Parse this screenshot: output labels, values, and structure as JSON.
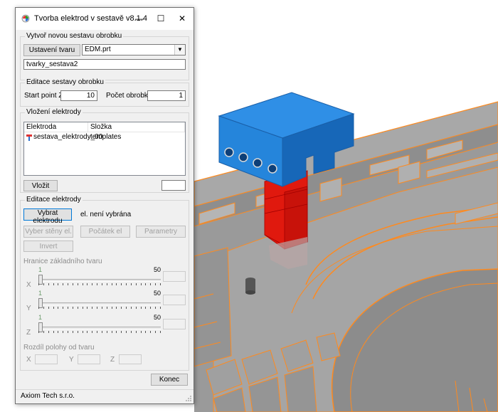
{
  "window": {
    "title": "Tvorba elektrod v sestavě v8.1.4"
  },
  "group_create_assembly": {
    "label": "Vytvoř novou sestavu obrobku",
    "shape_button": "Ustavení tvaru",
    "part_combo_value": "EDM.prt",
    "assembly_name_value": "tvarky_sestava2"
  },
  "group_edit_assembly": {
    "label": "Editace sestavy obrobku",
    "start_point_label": "Start point Z",
    "start_point_value": "10",
    "count_label": "Počet obrobků",
    "count_value": "1"
  },
  "group_insert_electrode": {
    "label": "Vložení elektrody",
    "columns": [
      "Elektroda",
      "Složka"
    ],
    "rows": [
      {
        "name": "sestava_elektrody_00",
        "folder": "templates"
      }
    ],
    "insert_button": "Vložit",
    "insert_count_value": ""
  },
  "group_edit_electrode": {
    "label": "Editace elektrody",
    "select_button": "Vybrat elektrodu",
    "select_status": "el. není vybrána",
    "select_faces_button": "Vyber stěny el.",
    "origin_button": "Počátek el",
    "params_button": "Parametry",
    "invert_button": "Invert",
    "shape_limits_label": "Hranice základního tvaru",
    "sliders": [
      {
        "axis": "X",
        "min": "1",
        "max": "50",
        "value": 1,
        "box_value": ""
      },
      {
        "axis": "Y",
        "min": "1",
        "max": "50",
        "value": 1,
        "box_value": ""
      },
      {
        "axis": "Z",
        "min": "1",
        "max": "50",
        "value": 1,
        "box_value": ""
      }
    ],
    "diff_label": "Rozdíl polohy od tvaru",
    "diff_x_label": "X",
    "diff_y_label": "Y",
    "diff_z_label": "Z"
  },
  "footer": {
    "end_button": "Konec",
    "company": "Axiom Tech s.r.o."
  },
  "colors": {
    "electrode_head": "#1e7fd6",
    "electrode_body": "#e0190e",
    "mold_highlight": "#ff8a1e",
    "mold_gray": "#9e9e9e"
  }
}
